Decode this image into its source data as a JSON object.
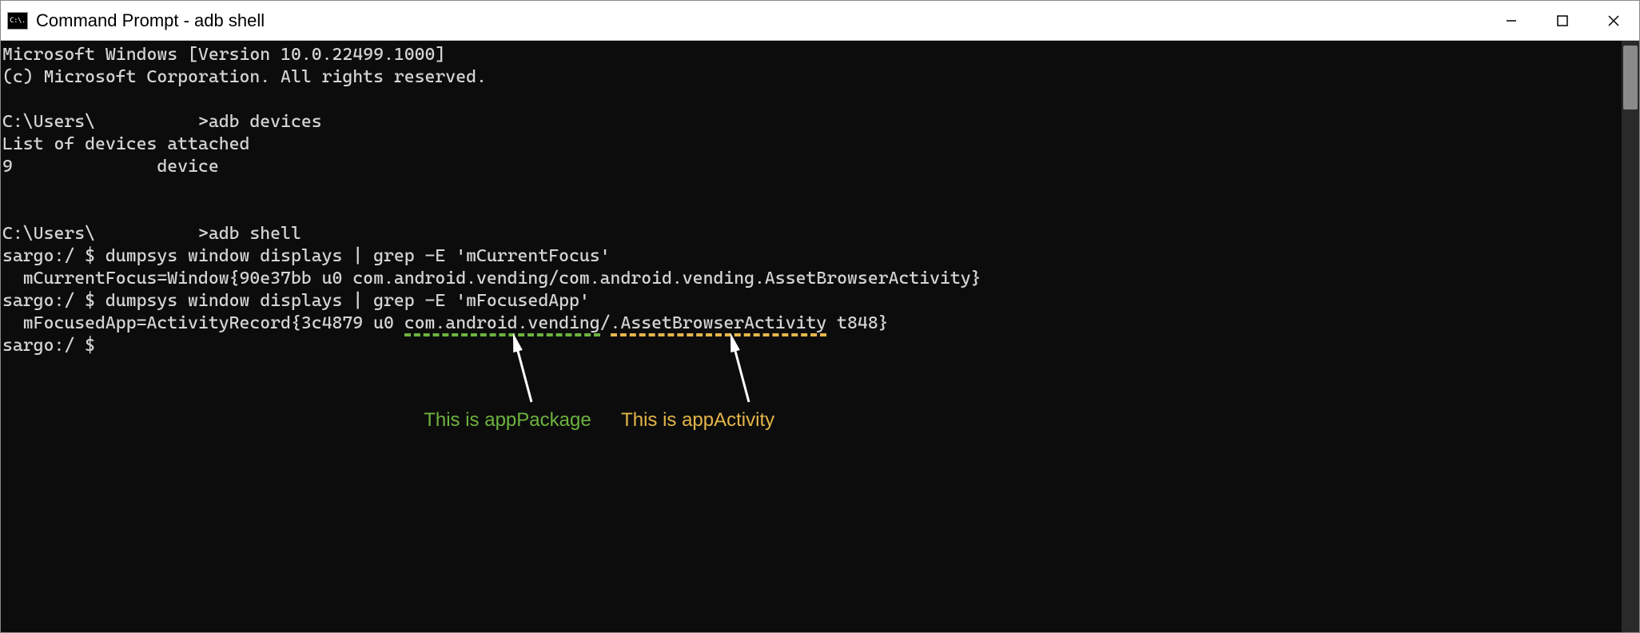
{
  "titlebar": {
    "icon_text": "C:\\.",
    "title": "Command Prompt - adb  shell"
  },
  "terminal": {
    "lines": [
      "Microsoft Windows [Version 10.0.22499.1000]",
      "(c) Microsoft Corporation. All rights reserved.",
      "",
      "C:\\Users\\          >adb devices",
      "List of devices attached",
      "9              device",
      "",
      "",
      "C:\\Users\\          >adb shell",
      "sargo:/ $ dumpsys window displays | grep -E 'mCurrentFocus'",
      "  mCurrentFocus=Window{90e37bb u0 com.android.vending/com.android.vending.AssetBrowserActivity}",
      "sargo:/ $ dumpsys window displays | grep -E 'mFocusedApp'",
      "  mFocusedApp=ActivityRecord{3c4879 u0 com.android.vending/.AssetBrowserActivity t848}",
      "sargo:/ $ "
    ]
  },
  "annotations": {
    "package_label": "This is appPackage",
    "activity_label": "This is appActivity",
    "package_value": "com.android.vending",
    "activity_value": ".AssetBrowserActivity",
    "colors": {
      "package": "#6db33f",
      "activity": "#e5b64a"
    }
  }
}
